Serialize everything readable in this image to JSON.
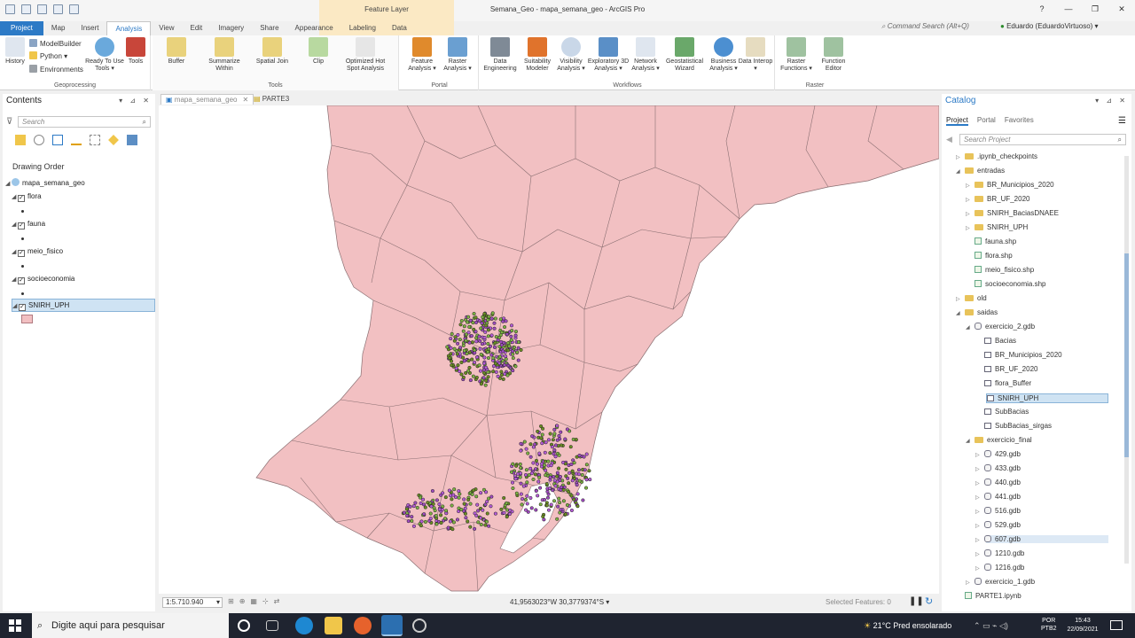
{
  "window": {
    "title": "Semana_Geo - mapa_semana_geo - ArcGIS Pro",
    "context_tab": "Feature Layer",
    "controls": [
      "?",
      "—",
      "❐",
      "✕"
    ]
  },
  "ribbon_tabs": [
    "Project",
    "Map",
    "Insert",
    "Analysis",
    "View",
    "Edit",
    "Imagery",
    "Share",
    "Appearance",
    "Labeling",
    "Data"
  ],
  "active_tab": "Analysis",
  "command_search": "Command Search (Alt+Q)",
  "user": "Eduardo (EduardoVirtuoso) ▾",
  "ribbon": {
    "geoprocessing": {
      "label": "Geoprocessing",
      "history": "History",
      "modelbuilder": "ModelBuilder",
      "python": "Python ▾",
      "environments": "Environments",
      "ready_to_use": "Ready To Use Tools ▾",
      "tools": "Tools"
    },
    "tools": {
      "label": "Tools",
      "buttons": [
        "Buffer",
        "Summarize Within",
        "Spatial Join",
        "Clip",
        "Optimized Hot Spot Analysis"
      ]
    },
    "portal": {
      "label": "Portal",
      "buttons": [
        "Feature Analysis ▾",
        "Raster Analysis ▾"
      ]
    },
    "workflows": {
      "label": "Workflows",
      "buttons": [
        "Data Engineering",
        "Suitability Modeler",
        "Visibility Analysis ▾",
        "Exploratory 3D Analysis ▾",
        "Network Analysis ▾",
        "Geostatistical Wizard",
        "Business Analysis ▾",
        "Data Interop ▾"
      ]
    },
    "raster": {
      "label": "Raster",
      "buttons": [
        "Raster Functions ▾",
        "Function Editor"
      ]
    }
  },
  "contents": {
    "title": "Contents",
    "search_placeholder": "Search",
    "drawing_order": "Drawing Order",
    "map_name": "mapa_semana_geo",
    "layers": [
      "flora",
      "fauna",
      "meio_fisico",
      "socioeconomia",
      "SNIRH_UPH"
    ]
  },
  "map_tabs": [
    "mapa_semana_geo",
    "PARTE3"
  ],
  "status": {
    "scale": "1:5.710.940",
    "coords": "41,9563023°W 30,3779374°S",
    "selected": "Selected Features: 0"
  },
  "catalog": {
    "title": "Catalog",
    "tabs": [
      "Project",
      "Portal",
      "Favorites"
    ],
    "search_placeholder": "Search Project",
    "items": [
      {
        "label": ".ipynb_checkpoints",
        "icon": "folder",
        "indent": 0,
        "exp": "▷"
      },
      {
        "label": "entradas",
        "icon": "folder",
        "indent": 0,
        "exp": "◢"
      },
      {
        "label": "BR_Municipios_2020",
        "icon": "folder",
        "indent": 1,
        "exp": "▷"
      },
      {
        "label": "BR_UF_2020",
        "icon": "folder",
        "indent": 1,
        "exp": "▷"
      },
      {
        "label": "SNIRH_BaciasDNAEE",
        "icon": "folder",
        "indent": 1,
        "exp": "▷"
      },
      {
        "label": "SNIRH_UPH",
        "icon": "folder",
        "indent": 1,
        "exp": "▷"
      },
      {
        "label": "fauna.shp",
        "icon": "shp",
        "indent": 1,
        "exp": ""
      },
      {
        "label": "flora.shp",
        "icon": "shp",
        "indent": 1,
        "exp": ""
      },
      {
        "label": "meio_fisico.shp",
        "icon": "shp",
        "indent": 1,
        "exp": ""
      },
      {
        "label": "socioeconomia.shp",
        "icon": "shp",
        "indent": 1,
        "exp": ""
      },
      {
        "label": "old",
        "icon": "folder",
        "indent": 0,
        "exp": "▷"
      },
      {
        "label": "saidas",
        "icon": "folder",
        "indent": 0,
        "exp": "◢"
      },
      {
        "label": "exercicio_2.gdb",
        "icon": "gdb",
        "indent": 1,
        "exp": "◢"
      },
      {
        "label": "Bacias",
        "icon": "fc",
        "indent": 2,
        "exp": ""
      },
      {
        "label": "BR_Municipios_2020",
        "icon": "fc",
        "indent": 2,
        "exp": ""
      },
      {
        "label": "BR_UF_2020",
        "icon": "fc",
        "indent": 2,
        "exp": ""
      },
      {
        "label": "flora_Buffer",
        "icon": "fc",
        "indent": 2,
        "exp": ""
      },
      {
        "label": "SNIRH_UPH",
        "icon": "fc",
        "indent": 2,
        "exp": "",
        "selected": true
      },
      {
        "label": "SubBacias",
        "icon": "fc",
        "indent": 2,
        "exp": ""
      },
      {
        "label": "SubBacias_sirgas",
        "icon": "fc",
        "indent": 2,
        "exp": ""
      },
      {
        "label": "exercicio_final",
        "icon": "folder",
        "indent": 1,
        "exp": "◢"
      },
      {
        "label": "429.gdb",
        "icon": "gdb",
        "indent": 2,
        "exp": "▷"
      },
      {
        "label": "433.gdb",
        "icon": "gdb",
        "indent": 2,
        "exp": "▷"
      },
      {
        "label": "440.gdb",
        "icon": "gdb",
        "indent": 2,
        "exp": "▷"
      },
      {
        "label": "441.gdb",
        "icon": "gdb",
        "indent": 2,
        "exp": "▷"
      },
      {
        "label": "516.gdb",
        "icon": "gdb",
        "indent": 2,
        "exp": "▷"
      },
      {
        "label": "529.gdb",
        "icon": "gdb",
        "indent": 2,
        "exp": "▷"
      },
      {
        "label": "607.gdb",
        "icon": "gdb",
        "indent": 2,
        "exp": "▷",
        "hover": true
      },
      {
        "label": "1210.gdb",
        "icon": "gdb",
        "indent": 2,
        "exp": "▷"
      },
      {
        "label": "1216.gdb",
        "icon": "gdb",
        "indent": 2,
        "exp": "▷"
      },
      {
        "label": "exercicio_1.gdb",
        "icon": "gdb",
        "indent": 1,
        "exp": "▷"
      },
      {
        "label": "PARTE1.ipynb",
        "icon": "shp",
        "indent": 0,
        "exp": ""
      }
    ]
  },
  "taskbar": {
    "search": "Digite aqui para pesquisar",
    "weather": "21°C  Pred ensolarado",
    "lang": "POR\nPTB2",
    "time": "15:43",
    "date": "22/09/2021"
  },
  "colors": {
    "accent": "#2c7ac6",
    "polygon": "#f2c0c2",
    "polygon_stroke": "#8a6f72",
    "flora": "#7cb342",
    "fauna": "#b55bd6",
    "context": "#fbe9c4"
  }
}
